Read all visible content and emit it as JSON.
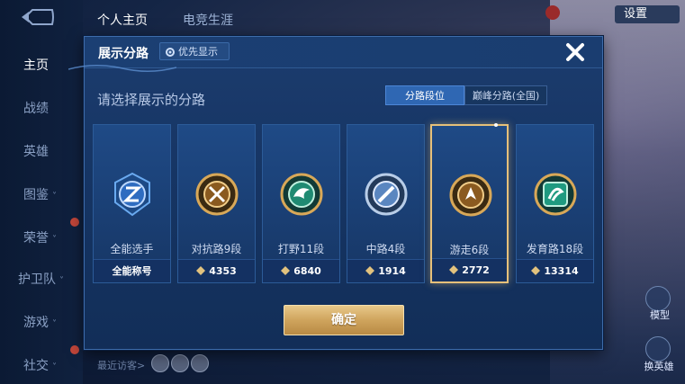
{
  "sidebar": {
    "items": [
      {
        "label": "主页",
        "active": true
      },
      {
        "label": "战绩"
      },
      {
        "label": "英雄"
      },
      {
        "label": "图鉴",
        "caret": "˅"
      },
      {
        "label": "荣誉",
        "caret": "˅"
      },
      {
        "label": "护卫队",
        "caret": "˅"
      },
      {
        "label": "游戏",
        "caret": "˅"
      },
      {
        "label": "社交",
        "caret": "˅"
      }
    ]
  },
  "top_tabs": [
    {
      "label": "个人主页",
      "active": true
    },
    {
      "label": "电竞生涯"
    }
  ],
  "top_right": {
    "label": "设置"
  },
  "bottom": {
    "visitor_label": "最近访客>",
    "right_buttons": [
      "模型",
      "换英雄"
    ]
  },
  "modal": {
    "title": "展示分路",
    "priority_label": "优先显示",
    "subtitle": "请选择展示的分路",
    "segments": [
      "分路段位",
      "巅峰分路(全国)"
    ],
    "cards": [
      {
        "name": "全能选手",
        "footer": "全能称号",
        "emblem": "all-round-emblem",
        "color": "#3d7ed8"
      },
      {
        "name": "对抗路9段",
        "points": "4353",
        "emblem": "clash-lane-emblem",
        "color": "#c9923f"
      },
      {
        "name": "打野11段",
        "points": "6840",
        "emblem": "jungle-emblem",
        "color": "#2aa888"
      },
      {
        "name": "中路4段",
        "points": "1914",
        "emblem": "mid-lane-emblem",
        "color": "#7fa8d8"
      },
      {
        "name": "游走6段",
        "points": "2772",
        "emblem": "roam-emblem",
        "color": "#c9923f",
        "selected": true
      },
      {
        "name": "发育路18段",
        "points": "13314",
        "emblem": "farm-lane-emblem",
        "color": "#2aa888"
      }
    ],
    "confirm_label": "确定"
  }
}
